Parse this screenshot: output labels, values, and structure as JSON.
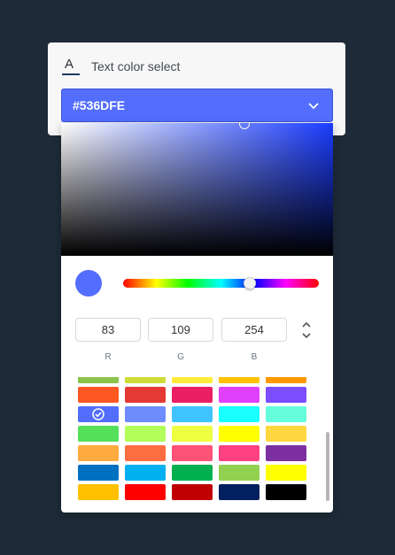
{
  "field": {
    "label": "Text color select",
    "icon": "text-color-icon",
    "icon_glyph": "A",
    "value": "#536DFE",
    "accent": "#536dfe"
  },
  "picker": {
    "current_color": "#536dfe",
    "hue_color": "#1a3cff",
    "rgb": {
      "r": {
        "label": "R",
        "value": "83"
      },
      "g": {
        "label": "G",
        "value": "109"
      },
      "b": {
        "label": "B",
        "value": "254"
      }
    },
    "swatches": [
      [
        "#8bc34a",
        "#cddc39",
        "#ffeb3b",
        "#ffc107",
        "#ff9800"
      ],
      [
        "#ff5722",
        "#e53935",
        "#e91e63",
        "#e040fb",
        "#7c4dff"
      ],
      [
        "#536dfe",
        "#6f8cff",
        "#40c4ff",
        "#18ffff",
        "#64ffda"
      ],
      [
        "#55e05a",
        "#b2ff59",
        "#eeff41",
        "#ffff00",
        "#ffd740"
      ],
      [
        "#ffab40",
        "#ff6e40",
        "#ff5277",
        "#ff4081",
        "#7b2fa0"
      ],
      [
        "#0070c0",
        "#00b0f0",
        "#00b050",
        "#92d050",
        "#ffff00"
      ],
      [
        "#ffc000",
        "#ff0000",
        "#c00000",
        "#002060",
        "#000000"
      ]
    ],
    "selected_swatch": "#536dfe"
  }
}
